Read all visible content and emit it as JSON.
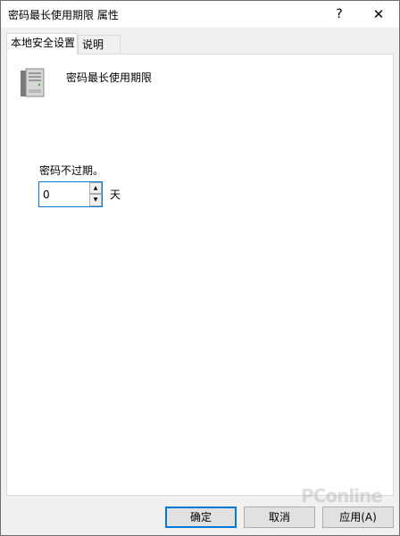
{
  "window": {
    "title": "密码最长使用期限 属性",
    "help_label": "?",
    "close_label": "✕"
  },
  "tabs": [
    {
      "label": "本地安全设置",
      "active": true
    },
    {
      "label": "说明",
      "active": false
    }
  ],
  "policy": {
    "name": "密码最长使用期限",
    "icon": "server-icon"
  },
  "setting": {
    "label": "密码不过期。",
    "value": "0",
    "unit": "天"
  },
  "buttons": {
    "ok": "确定",
    "cancel": "取消",
    "apply": "应用(A)"
  },
  "watermark": {
    "text": "PConline"
  },
  "colors": {
    "accent": "#0078d7"
  }
}
